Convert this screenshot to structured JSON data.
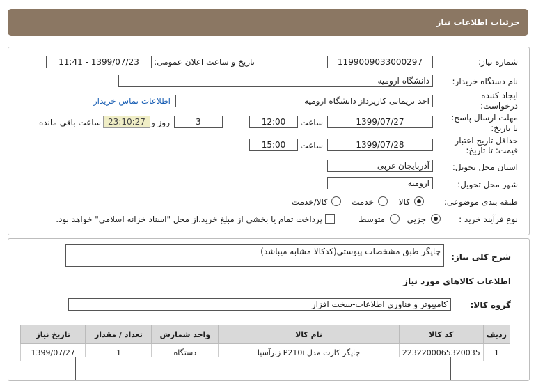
{
  "header": {
    "title": "جزئیات اطلاعات نیاز"
  },
  "form": {
    "need_number_label": "شماره نیاز:",
    "need_number": "1199009033000297",
    "announce_label": "تاریخ و ساعت اعلان عمومی:",
    "announce_value": "1399/07/23 - 11:41",
    "buyer_label": "نام دستگاه خریدار:",
    "buyer_value": "دانشگاه ارومیه",
    "creator_label_1": "ایجاد کننده",
    "creator_label_2": "درخواست:",
    "creator_value": "احد نریمانی کارپرداز دانشگاه ارومیه",
    "contact_link": "اطلاعات تماس خریدار",
    "deadline_label_1": "مهلت ارسال پاسخ:",
    "deadline_label_2": "تا تاریخ:",
    "deadline_date": "1399/07/27",
    "time_label": "ساعت",
    "deadline_time": "12:00",
    "days_value": "3",
    "days_label": "روز و",
    "timer_value": "23:10:27",
    "remaining_label": "ساعت باقی مانده",
    "validity_label_1": "حداقل تاریخ اعتبار",
    "validity_label_2": "قیمت: تا تاریخ:",
    "validity_date": "1399/07/28",
    "validity_time": "15:00",
    "province_label": "استان محل تحویل:",
    "province_value": "آذربایجان غربی",
    "city_label": "شهر محل تحویل:",
    "city_value": "ارومیه",
    "category_label": "طبقه بندی موضوعی:",
    "category_options": [
      "کالا",
      "خدمت",
      "کالا/خدمت"
    ],
    "category_selected": "کالا",
    "process_label": "نوع فرآیند خرید :",
    "process_options": [
      "جزیی",
      "متوسط"
    ],
    "process_selected": "جزیی",
    "payment_note": "پرداخت تمام یا بخشی از مبلغ خرید،از محل \"اسناد خزانه اسلامی\" خواهد بود."
  },
  "description": {
    "label": "شرح کلی نیاز:",
    "value": "چاپگر  طبق مشخصات پیوستی(کدکالا مشابه میباشد)"
  },
  "goods": {
    "section_title": "اطلاعات کالاهای مورد نیاز",
    "group_label": "گروه کالا:",
    "group_value": "کامپیوتر و فناوری اطلاعات-سخت افزار",
    "table": {
      "headers": [
        "ردیف",
        "کد کالا",
        "نام کالا",
        "واحد شمارش",
        "تعداد / مقدار",
        "تاریخ نیاز"
      ],
      "rows": [
        [
          "1",
          "2232200065320035",
          "چاپگر کارت مدل P210i زبرآسیا",
          "دستگاه",
          "1",
          "1399/07/27"
        ]
      ]
    }
  }
}
